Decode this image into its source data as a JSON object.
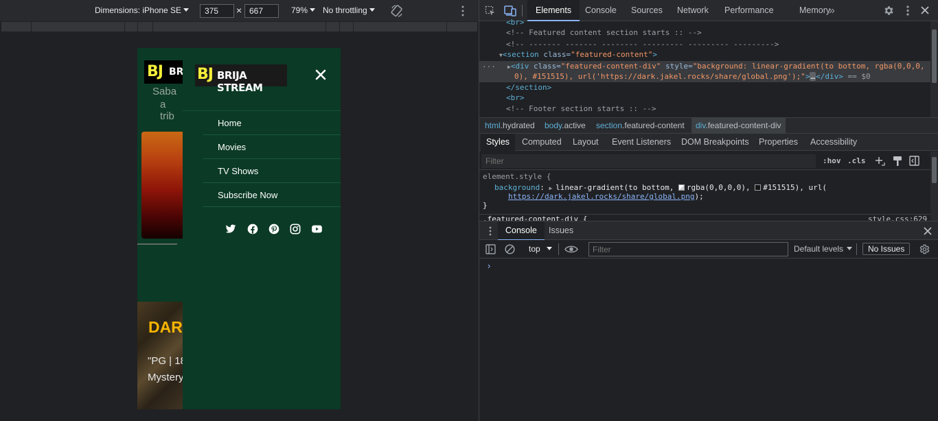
{
  "device_toolbar": {
    "dimensions_label": "Dimensions: iPhone SE",
    "width": "375",
    "height": "667",
    "times": "×",
    "zoom": "79%",
    "throttling": "No throttling"
  },
  "phone": {
    "bg": {
      "logo_bj": "BJ",
      "logo_brij": "BRI",
      "text1": "Saba",
      "text2": "a trib",
      "feature_title": "DAR",
      "feature_meta": "\"PG | 18",
      "feature_genre": "Mystery"
    },
    "drawer": {
      "logo_bj": "BJ",
      "logo_name": "BRIJA STREAM",
      "nav": [
        {
          "label": "Home"
        },
        {
          "label": "Movies"
        },
        {
          "label": "TV Shows"
        },
        {
          "label": "Subscribe Now"
        }
      ],
      "social_icons": [
        "twitter-icon",
        "facebook-icon",
        "pinterest-icon",
        "instagram-icon",
        "youtube-icon"
      ]
    }
  },
  "devtools": {
    "tabs": [
      {
        "label": "Elements"
      },
      {
        "label": "Console"
      },
      {
        "label": "Sources"
      },
      {
        "label": "Network"
      },
      {
        "label": "Performance"
      },
      {
        "label": "Memory"
      }
    ],
    "more_tabs": "»",
    "elements": {
      "line0": "<br>",
      "line1": "<!-- Featured content section starts :: -->",
      "line2": "<!-- ------- -------    --------   ---------    --------- --------->",
      "section_tag": "<section",
      "section_attr": " class=",
      "section_val": "\"featured-content\"",
      "section_close_bracket": ">",
      "div_tag": "<div",
      "div_attr1": " class=",
      "div_val1": "\"featured-content-div\"",
      "div_attr2": " style=",
      "div_val2a": "\"background: linear-gradient(to bottom, rgba(0,0,0,",
      "div_val2b": "0), #151515), url('https://dark.jakel.rocks/share/global.png');\"",
      "div_gt": ">",
      "div_ellipsis": "…",
      "div_close": "</div>",
      "div_eq": " == $0",
      "section_end": "</section>",
      "line_br": "<br>",
      "line_footer": "<!-- Footer section starts :: -->",
      "dots": "···"
    },
    "breadcrumbs": [
      {
        "tag": "html",
        "cls": ".hydrated"
      },
      {
        "tag": "body",
        "cls": ".active"
      },
      {
        "tag": "section",
        "cls": ".featured-content"
      },
      {
        "tag": "div",
        "cls": ".featured-content-div"
      }
    ],
    "sub_tabs": [
      {
        "label": "Styles"
      },
      {
        "label": "Computed"
      },
      {
        "label": "Layout"
      },
      {
        "label": "Event Listeners"
      },
      {
        "label": "DOM Breakpoints"
      },
      {
        "label": "Properties"
      },
      {
        "label": "Accessibility"
      }
    ],
    "styles": {
      "filter_placeholder": "Filter",
      "hov": ":hov",
      "cls": ".cls",
      "element_style": "element.style {",
      "prop": "background",
      "colon": ": ",
      "value_a": "linear-gradient(to bottom, ",
      "value_b": "rgba(0,0,0,0), ",
      "value_c": "#151515), url(",
      "url": "https://dark.jakel.rocks/share/global.png",
      "url_end": ");",
      "close_brace": "}",
      "next_rule": ".featured-content-div {",
      "source": "style.css:629"
    },
    "drawer_tabs": [
      {
        "label": "Console"
      },
      {
        "label": "Issues"
      }
    ],
    "console": {
      "context": "top",
      "filter_placeholder": "Filter",
      "levels": "Default levels",
      "issues": "No Issues",
      "prompt": "›"
    },
    "colors": {
      "accent": "#8ab4f8",
      "drawer_bg": "#0b3a26",
      "logo_yellow": "#f4ee3a",
      "feature_title": "#f7b500"
    }
  }
}
